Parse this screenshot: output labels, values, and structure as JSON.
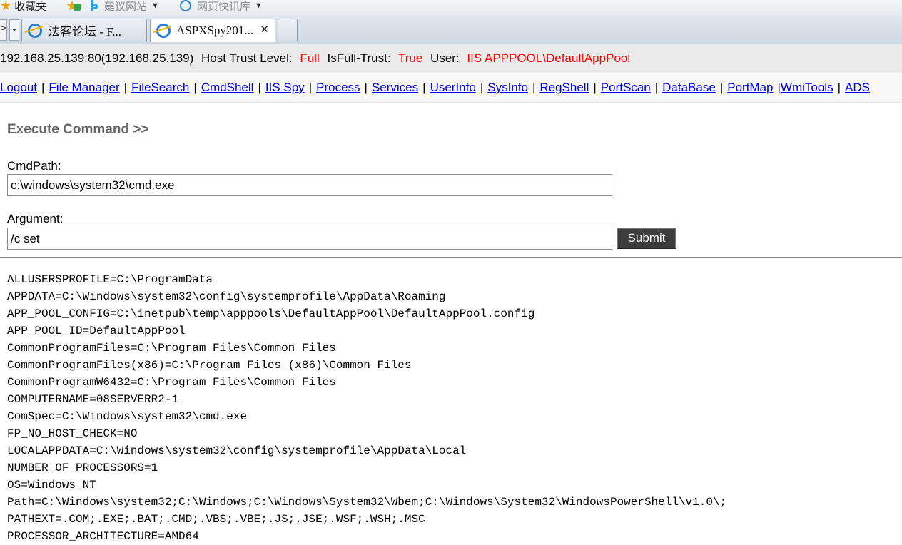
{
  "favorites_bar": {
    "favorites_label": "收藏夹",
    "suggested_sites": "建议网站",
    "web_slice_gallery": "网页快讯库"
  },
  "tabs": [
    {
      "title": "法客论坛 - F...",
      "active": false
    },
    {
      "title": "ASPXSpy201...",
      "active": true
    }
  ],
  "server_info": {
    "address": "192.168.25.139:80(192.168.25.139)",
    "host_trust_label": "Host Trust Level:",
    "host_trust_value": "Full",
    "full_trust_label": "IsFull-Trust:",
    "full_trust_value": "True",
    "user_label": "User:",
    "user_value": "IIS APPPOOL\\DefaultAppPool"
  },
  "nav": {
    "links": [
      "Logout",
      "File Manager",
      "FileSearch",
      "CmdShell",
      "IIS Spy",
      "Process",
      "Services",
      "UserInfo",
      "SysInfo",
      "RegShell",
      "PortScan",
      "DataBase",
      "PortMap",
      "WmiTools",
      "ADS"
    ]
  },
  "command": {
    "section_title": "Execute Command >>",
    "cmdpath_label": "CmdPath:",
    "cmdpath_value": "c:\\windows\\system32\\cmd.exe",
    "argument_label": "Argument:",
    "argument_value": "/c set",
    "submit_label": "Submit"
  },
  "output": {
    "lines": [
      "ALLUSERSPROFILE=C:\\ProgramData",
      "APPDATA=C:\\Windows\\system32\\config\\systemprofile\\AppData\\Roaming",
      "APP_POOL_CONFIG=C:\\inetpub\\temp\\apppools\\DefaultAppPool\\DefaultAppPool.config",
      "APP_POOL_ID=DefaultAppPool",
      "CommonProgramFiles=C:\\Program Files\\Common Files",
      "CommonProgramFiles(x86)=C:\\Program Files (x86)\\Common Files",
      "CommonProgramW6432=C:\\Program Files\\Common Files",
      "COMPUTERNAME=08SERVERR2-1",
      "ComSpec=C:\\Windows\\system32\\cmd.exe",
      "FP_NO_HOST_CHECK=NO",
      "LOCALAPPDATA=C:\\Windows\\system32\\config\\systemprofile\\AppData\\Local",
      "NUMBER_OF_PROCESSORS=1",
      "OS=Windows_NT",
      "Path=C:\\Windows\\system32;C:\\Windows;C:\\Windows\\System32\\Wbem;C:\\Windows\\System32\\WindowsPowerShell\\v1.0\\;",
      "PATHEXT=.COM;.EXE;.BAT;.CMD;.VBS;.VBE;.JS;.JSE;.WSF;.WSH;.MSC",
      "PROCESSOR_ARCHITECTURE=AMD64"
    ]
  }
}
